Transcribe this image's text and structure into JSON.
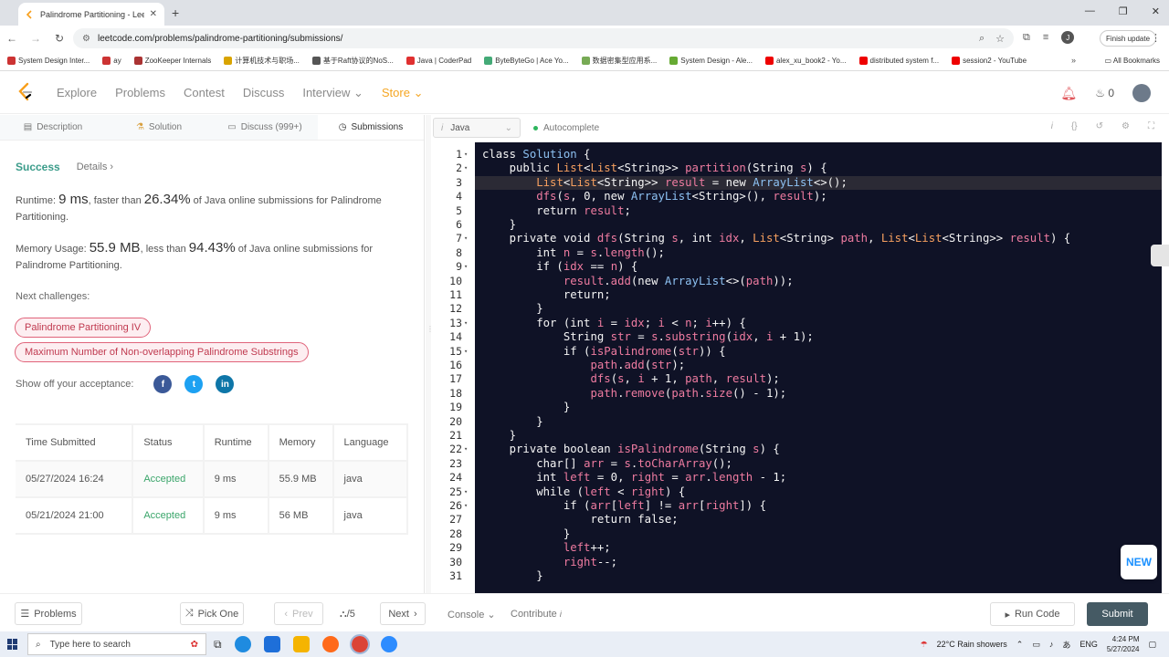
{
  "browser": {
    "tab_title": "Palindrome Partitioning - LeetC",
    "url": "leetcode.com/problems/palindrome-partitioning/submissions/",
    "finish_update": "Finish update",
    "profile_letter": "J",
    "bookmarks": [
      {
        "label": "System Design Inter...",
        "color": "#c33"
      },
      {
        "label": "ay",
        "color": "#c33"
      },
      {
        "label": "ZooKeeper Internals",
        "color": "#a33"
      },
      {
        "label": "计算机技术与职场...",
        "color": "#d9a400"
      },
      {
        "label": "基于Raft协议的NoS...",
        "color": "#555"
      },
      {
        "label": "Java | CoderPad",
        "color": "#e03030"
      },
      {
        "label": "ByteByteGo | Ace Yo...",
        "color": "#4a7"
      },
      {
        "label": "数据密集型应用系...",
        "color": "#7a5"
      },
      {
        "label": "System Design - Ale...",
        "color": "#6a3"
      },
      {
        "label": "alex_xu_book2 - Yo...",
        "color": "#e00"
      },
      {
        "label": "distributed system f...",
        "color": "#e00"
      },
      {
        "label": "session2 - YouTube",
        "color": "#e00"
      }
    ],
    "all_bookmarks": "All Bookmarks"
  },
  "nav": {
    "items": [
      "Explore",
      "Problems",
      "Contest",
      "Discuss",
      "Interview"
    ],
    "store": "Store",
    "points": "0"
  },
  "left": {
    "tabs": [
      "Description",
      "Solution",
      "Discuss (999+)",
      "Submissions"
    ],
    "success": "Success",
    "details": "Details",
    "runtime_prefix": "Runtime: ",
    "runtime": "9 ms",
    "runtime_mid": ", faster than ",
    "runtime_pct": "26.34%",
    "runtime_suffix": " of Java online submissions for Palindrome Partitioning.",
    "memory_prefix": "Memory Usage: ",
    "memory": "55.9 MB",
    "memory_mid": ", less than ",
    "memory_pct": "94.43%",
    "memory_suffix": " of Java online submissions for Palindrome Partitioning.",
    "next_challenges": "Next challenges:",
    "challenges": [
      "Palindrome Partitioning IV",
      "Maximum Number of Non-overlapping Palindrome Substrings"
    ],
    "show_off": "Show off your acceptance:",
    "table": {
      "headers": [
        "Time Submitted",
        "Status",
        "Runtime",
        "Memory",
        "Language"
      ],
      "rows": [
        [
          "05/27/2024 16:24",
          "Accepted",
          "9 ms",
          "55.9 MB",
          "java"
        ],
        [
          "05/21/2024 21:00",
          "Accepted",
          "9 ms",
          "56 MB",
          "java"
        ]
      ]
    }
  },
  "editor": {
    "language": "Java",
    "autocomplete": "Autocomplete",
    "lines": [
      "class Solution {",
      "    public List<List<String>> partition(String s) {",
      "        List<List<String>> result = new ArrayList<>();",
      "        dfs(s, 0, new ArrayList<String>(), result);",
      "        return result;",
      "    }",
      "    private void dfs(String s, int idx, List<String> path, List<List<String>> result) {",
      "        int n = s.length();",
      "        if (idx == n) {",
      "            result.add(new ArrayList<>(path));",
      "            return;",
      "        }",
      "        for (int i = idx; i < n; i++) {",
      "            String str = s.substring(idx, i + 1);",
      "            if (isPalindrome(str)) {",
      "                path.add(str);",
      "                dfs(s, i + 1, path, result);",
      "                path.remove(path.size() - 1);",
      "            }",
      "        }",
      "    }",
      "    private boolean isPalindrome(String s) {",
      "        char[] arr = s.toCharArray();",
      "        int left = 0, right = arr.length - 1;",
      "        while (left < right) {",
      "            if (arr[left] != arr[right]) {",
      "                return false;",
      "            }",
      "            left++;",
      "            right--;",
      "        }"
    ],
    "fold_lines": [
      1,
      2,
      7,
      9,
      13,
      15,
      22,
      25,
      26
    ],
    "highlight_line": 3,
    "new_badge": "NEW"
  },
  "bottom": {
    "problems": "Problems",
    "pick_one": "Pick One",
    "prev": "Prev",
    "page": "/5",
    "next": "Next",
    "console": "Console",
    "contribute": "Contribute",
    "run_code": "Run Code",
    "submit": "Submit"
  },
  "taskbar": {
    "search_placeholder": "Type here to search",
    "weather": "22°C  Rain showers",
    "lang": "ENG",
    "time": "4:24 PM",
    "date": "5/27/2024"
  }
}
